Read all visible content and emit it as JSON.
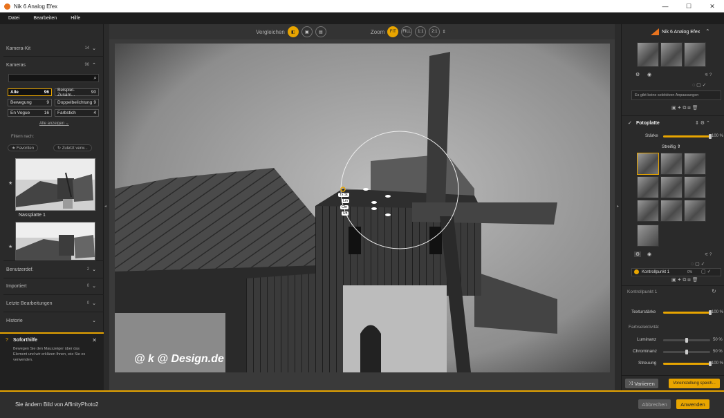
{
  "window": {
    "title": "Nik 6 Analog Efex",
    "minimize": "—",
    "maximize": "☐",
    "close": "✕"
  },
  "menu": {
    "items": [
      "Datei",
      "Bearbeiten",
      "Hilfe"
    ]
  },
  "left": {
    "kamera_kit": {
      "label": "Kamera-Kit",
      "count": "14"
    },
    "kameras": {
      "label": "Kameras",
      "count": "96"
    },
    "chips": [
      {
        "label": "Alle",
        "count": "96"
      },
      {
        "label": "Beispiel-Zusam...",
        "count": "90"
      },
      {
        "label": "Bewegung",
        "count": "9"
      },
      {
        "label": "Doppelbelichtung",
        "count": "9"
      },
      {
        "label": "En Vogue",
        "count": "16"
      },
      {
        "label": "Farbstich",
        "count": "4"
      }
    ],
    "show_all": "Alle anzeigen",
    "filter_label": "Filtern nach:",
    "pill_fav": "★ Favoriten",
    "pill_recent": "↻ Zuletzt verw...",
    "preset_name": "Nassplatte 1",
    "sections": [
      {
        "label": "Benutzerdef.",
        "count": "2"
      },
      {
        "label": "Importiert",
        "count": "0"
      },
      {
        "label": "Letzte Bearbeitungen",
        "count": "0"
      },
      {
        "label": "Historie",
        "count": ""
      }
    ],
    "sofort": {
      "title": "Soforthilfe",
      "text": "Bewegen Sie den Mauszeiger über das Element und wir erklären Ihnen, wie Sie es verwenden.",
      "close": "✕"
    }
  },
  "topbar": {
    "compare": "Vergleichen",
    "zoom": "Zoom",
    "fit": "FIT",
    "fill": "FILL",
    "z11": "1:1",
    "z21": "2:1"
  },
  "canvas": {
    "watermark": "@ k @ Design.de",
    "ctrl_labels": [
      "Tx St",
      "Lm",
      "Chr",
      "Üh"
    ]
  },
  "right": {
    "brand": "Nik 6 Analog Efex",
    "no_selective": "Es gibt keine selektiven Anpassungen",
    "fotoplatte": "Fotoplatte",
    "staerke": {
      "label": "Stärke",
      "value": "100 %",
      "level": 100
    },
    "streifig": "Streifig",
    "kontrollpunkt": {
      "label": "Kontrollpunkt 1",
      "value": "0%"
    },
    "kontrollpunkt_section": "Kontrollpunkt 1",
    "texturstaerke": {
      "label": "Texturstärke",
      "value": "100 %",
      "level": 100
    },
    "farbselektivitaet": "Farbselektivität",
    "luminanz": {
      "label": "Luminanz",
      "value": "50 %",
      "level": 50
    },
    "chrominanz": {
      "label": "Chrominanz",
      "value": "50 %",
      "level": 50
    },
    "streuung": {
      "label": "Streuung",
      "value": "100 %",
      "level": 100
    },
    "variieren": "Variieren",
    "voreinstellung": "Voreinstellung speich..."
  },
  "bottom": {
    "message": "Sie ändern Bild von AffinityPhoto2",
    "cancel": "Abbrechen",
    "apply": "Anwenden"
  },
  "colors": {
    "accent": "#e8a500",
    "panel": "#2a2a2a",
    "titlebar": "#ffffff"
  }
}
